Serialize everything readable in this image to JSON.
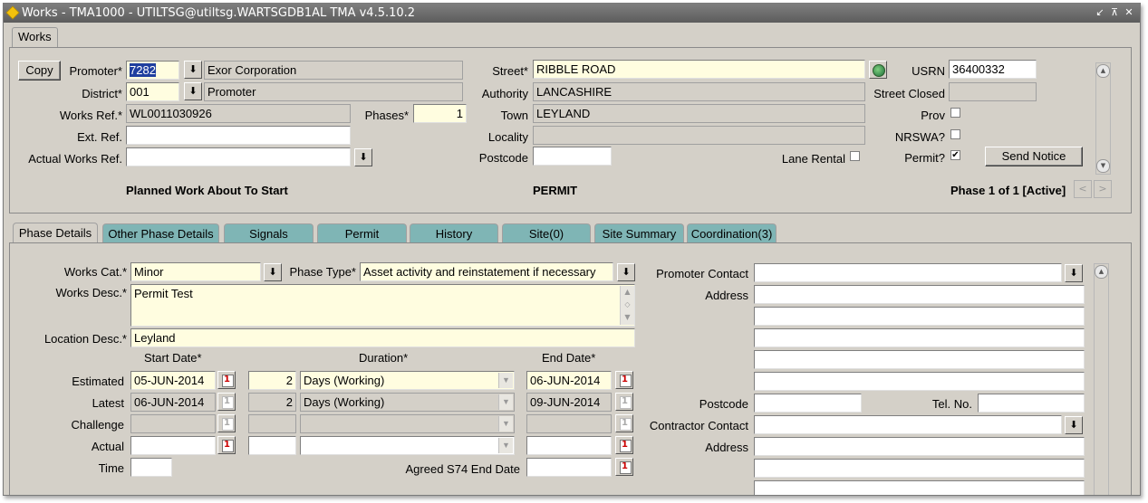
{
  "window": {
    "title": "Works - TMA1000 - UTILTSG@utiltsg.WARTSGDB1AL TMA v4.5.10.2",
    "title_buttons": [
      "↙",
      "⊼",
      "✕"
    ]
  },
  "top_tab": "Works",
  "header": {
    "copy_button": "Copy",
    "promoter_label": "Promoter*",
    "promoter_code": "7282",
    "promoter_name": "Exor Corporation",
    "district_label": "District*",
    "district_code": "001",
    "district_name": "Promoter",
    "works_ref_label": "Works Ref.*",
    "works_ref": "WL0011030926",
    "phases_label": "Phases*",
    "phases": "1",
    "ext_ref_label": "Ext. Ref.",
    "ext_ref": "",
    "actual_works_ref_label": "Actual Works Ref.",
    "actual_works_ref": "",
    "street_label": "Street*",
    "street": "RIBBLE ROAD",
    "authority_label": "Authority",
    "authority": "LANCASHIRE",
    "town_label": "Town",
    "town": "LEYLAND",
    "locality_label": "Locality",
    "locality": "",
    "postcode_label": "Postcode",
    "postcode": "",
    "lane_rental_label": "Lane Rental",
    "usrn_label": "USRN",
    "usrn": "36400332",
    "street_closed_label": "Street Closed",
    "street_closed": "",
    "prov_label": "Prov",
    "nrswa_label": "NRSWA?",
    "permit_label": "Permit?",
    "permit_checked": "✔",
    "send_notice_button": "Send Notice",
    "status_left": "Planned Work About To Start",
    "status_mid": "PERMIT",
    "status_right": "Phase 1 of 1 [Active]",
    "nav_prev": "<",
    "nav_next": ">"
  },
  "tabs": [
    {
      "label": "Phase Details"
    },
    {
      "label": "Other Phase Details"
    },
    {
      "label": "Signals"
    },
    {
      "label": "Permit"
    },
    {
      "label": "History"
    },
    {
      "label": "Site(0)"
    },
    {
      "label": "Site Summary"
    },
    {
      "label": "Coordination(3)"
    }
  ],
  "phase": {
    "works_cat_label": "Works Cat.*",
    "works_cat": "Minor",
    "phase_type_label": "Phase Type*",
    "phase_type": "Asset activity and reinstatement if necessary",
    "works_desc_label": "Works Desc.*",
    "works_desc": "Permit Test",
    "location_desc_label": "Location Desc.*",
    "location_desc": "Leyland",
    "col_start": "Start Date*",
    "col_duration": "Duration*",
    "col_end": "End Date*",
    "rows": {
      "estimated": {
        "label": "Estimated",
        "start": "05-JUN-2014",
        "num": "2",
        "unit": "Days (Working)",
        "end": "06-JUN-2014"
      },
      "latest": {
        "label": "Latest",
        "start": "06-JUN-2014",
        "num": "2",
        "unit": "Days (Working)",
        "end": "09-JUN-2014"
      },
      "challenge": {
        "label": "Challenge",
        "start": "",
        "num": "",
        "unit": "",
        "end": ""
      },
      "actual": {
        "label": "Actual",
        "start": "",
        "num": "",
        "unit": "",
        "end": ""
      }
    },
    "time_label": "Time",
    "time": "",
    "agreed_label": "Agreed S74 End Date",
    "agreed": "",
    "promoter_contact_label": "Promoter Contact",
    "address_label": "Address",
    "postcode_label": "Postcode",
    "tel_label": "Tel. No.",
    "contractor_contact_label": "Contractor Contact",
    "address2_label": "Address"
  }
}
